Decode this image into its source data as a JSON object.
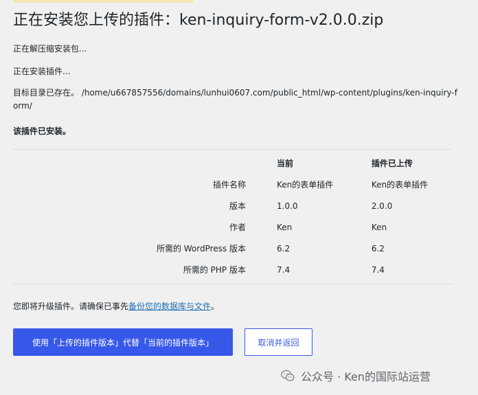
{
  "header": {
    "title": "正在安装您上传的插件：ken-inquiry-form-v2.0.0.zip"
  },
  "messages": {
    "unpacking": "正在解压缩安装包...",
    "installing": "正在安装插件...",
    "dir_exists": "目标目录已存在。 /home/u667857556/domains/lunhui0607.com/public_html/wp-content/plugins/ken-inquiry-form/",
    "already_installed": "该插件已安装。"
  },
  "comparison": {
    "headers": {
      "label": "",
      "current": "当前",
      "uploaded": "插件已上传"
    },
    "rows": [
      {
        "label": "插件名称",
        "current": "Ken的表单插件",
        "uploaded": "Ken的表单插件"
      },
      {
        "label": "版本",
        "current": "1.0.0",
        "uploaded": "2.0.0"
      },
      {
        "label": "作者",
        "current": "Ken",
        "uploaded": "Ken"
      },
      {
        "label": "所需的 WordPress 版本",
        "current": "6.2",
        "uploaded": "6.2"
      },
      {
        "label": "所需的 PHP 版本",
        "current": "7.4",
        "uploaded": "7.4"
      }
    ]
  },
  "upgrade_note": {
    "prefix": "您即将升级插件。请确保已事先",
    "link": "备份您的数据库与文件",
    "suffix": "。"
  },
  "actions": {
    "replace_label": "使用「上传的插件版本」代替「当前的插件版本」",
    "cancel_label": "取消并返回"
  },
  "watermark": {
    "text": "公众号 · Ken的国际站运营",
    "icon": "wechat-icon"
  },
  "colors": {
    "primary": "#3858e9",
    "link": "#2271b1",
    "background": "#f0f0f1"
  }
}
